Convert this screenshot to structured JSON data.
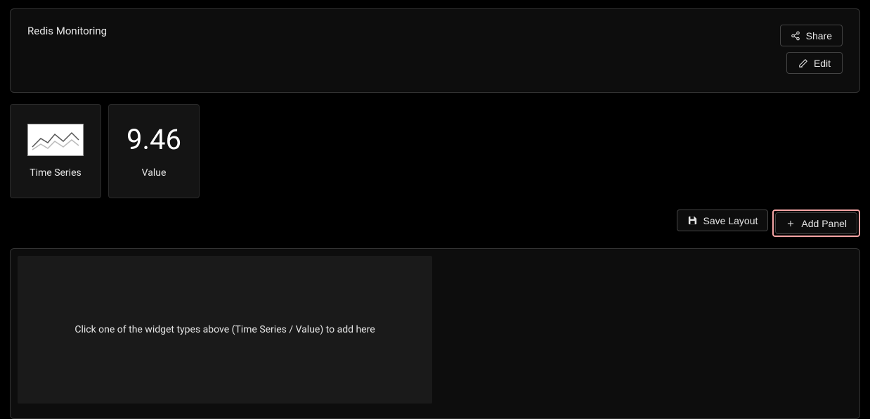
{
  "header": {
    "title": "Redis Monitoring",
    "share_label": "Share",
    "edit_label": "Edit"
  },
  "widgets": {
    "timeseries": {
      "label": "Time Series"
    },
    "value": {
      "display": "9.46",
      "label": "Value"
    }
  },
  "actions": {
    "save_layout_label": "Save Layout",
    "add_panel_label": "Add Panel"
  },
  "drop_area": {
    "hint": "Click one of the widget types above (Time Series / Value) to add here"
  }
}
